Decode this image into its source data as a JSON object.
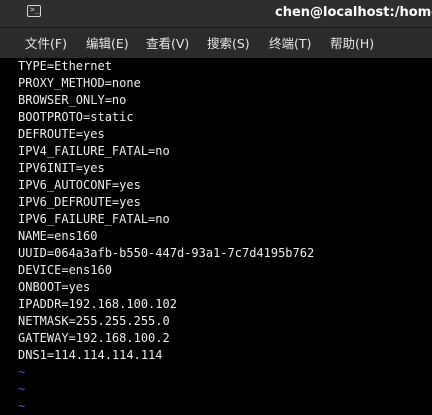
{
  "window": {
    "title": "chen@localhost:/home/c"
  },
  "menubar": {
    "items": [
      "文件(F)",
      "编辑(E)",
      "查看(V)",
      "搜索(S)",
      "终端(T)",
      "帮助(H)"
    ]
  },
  "terminal": {
    "lines": [
      "TYPE=Ethernet",
      "PROXY_METHOD=none",
      "BROWSER_ONLY=no",
      "BOOTPROTO=static",
      "DEFROUTE=yes",
      "IPV4_FAILURE_FATAL=no",
      "IPV6INIT=yes",
      "IPV6_AUTOCONF=yes",
      "IPV6_DEFROUTE=yes",
      "IPV6_FAILURE_FATAL=no",
      "NAME=ens160",
      "UUID=064a3afb-b550-447d-93a1-7c7d4195b762",
      "DEVICE=ens160",
      "ONBOOT=yes",
      "IPADDR=192.168.100.102",
      "NETMASK=255.255.255.0",
      "GATEWAY=192.168.100.2",
      "DNS1=114.114.114.114"
    ],
    "empty_markers": [
      "~",
      "~",
      "~"
    ]
  },
  "icons": {
    "titlebar_icon": "terminal-icon"
  }
}
